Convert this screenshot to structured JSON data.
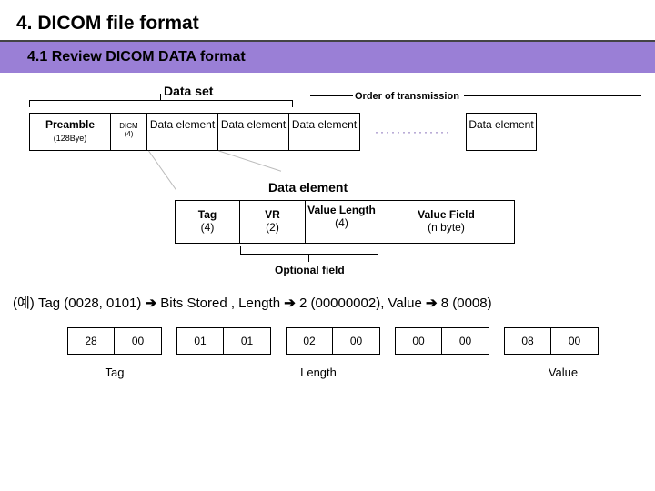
{
  "title": "4. DICOM file format",
  "subtitle": "4.1 Review DICOM DATA format",
  "dataset_label": "Data set",
  "order_label": "Order of transmission",
  "row1": {
    "preamble": "Preamble",
    "preamble_sub": "(128Bye)",
    "dicm": "DICM",
    "dicm_sub": "(4)",
    "de": "Data element",
    "dots": "··············"
  },
  "de_title": "Data element",
  "row2": {
    "tag": "Tag",
    "tag_sub": "(4)",
    "vr": "VR",
    "vr_sub": "(2)",
    "vl": "Value Length",
    "vl_sub": "(4)",
    "vf": "Value Field",
    "vf_sub": "(n byte)"
  },
  "optional_label": "Optional field",
  "example_prefix": "(예) Tag (0028, 0101)",
  "example_arrow": "➔",
  "example_mid1": " Bits Stored , Length",
  "example_mid2": "2 (00000002), Value ",
  "example_end": " 8 (0008)",
  "bytes": [
    "28",
    "00",
    "01",
    "01",
    "02",
    "00",
    "00",
    "00",
    "08",
    "00"
  ],
  "labels": {
    "tag": "Tag",
    "length": "Length",
    "value": "Value"
  }
}
